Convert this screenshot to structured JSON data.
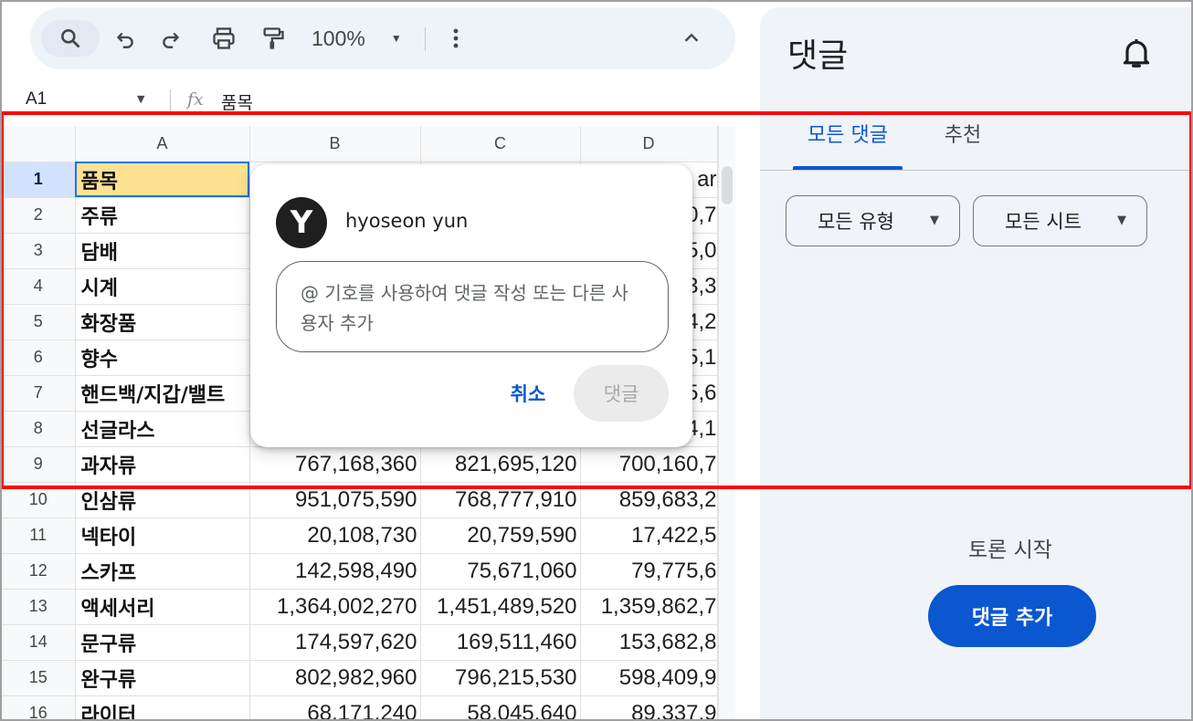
{
  "toolbar": {
    "zoom": "100%",
    "icons": [
      "search-icon",
      "undo-icon",
      "redo-icon",
      "print-icon",
      "paint-format-icon",
      "chevron-down-icon",
      "more-vert-icon",
      "chevron-up-icon"
    ]
  },
  "formula_bar": {
    "cell_ref": "A1",
    "fx": "fx",
    "value": "품목"
  },
  "grid": {
    "columns": [
      "A",
      "B",
      "C",
      "D"
    ],
    "rows": [
      {
        "n": "1",
        "a": "품목",
        "b": "",
        "c": "",
        "d": "ar"
      },
      {
        "n": "2",
        "a": "주류",
        "b": "",
        "c": "",
        "d": "0,7"
      },
      {
        "n": "3",
        "a": "담배",
        "b": "",
        "c": "",
        "d": "5,0"
      },
      {
        "n": "4",
        "a": "시계",
        "b": "",
        "c": "",
        "d": "3,3"
      },
      {
        "n": "5",
        "a": "화장품",
        "b": "",
        "c": "",
        "d": "4,2"
      },
      {
        "n": "6",
        "a": "향수",
        "b": "",
        "c": "",
        "d": "5,1"
      },
      {
        "n": "7",
        "a": "핸드백/지갑/밸트",
        "b": "",
        "c": "",
        "d": "5,6"
      },
      {
        "n": "8",
        "a": "선글라스",
        "b": "",
        "c": "",
        "d": "4,1"
      },
      {
        "n": "9",
        "a": "과자류",
        "b": "767,168,360",
        "c": "821,695,120",
        "d": "700,160,7"
      },
      {
        "n": "10",
        "a": "인삼류",
        "b": "951,075,590",
        "c": "768,777,910",
        "d": "859,683,2"
      },
      {
        "n": "11",
        "a": "넥타이",
        "b": "20,108,730",
        "c": "20,759,590",
        "d": "17,422,5"
      },
      {
        "n": "12",
        "a": "스카프",
        "b": "142,598,490",
        "c": "75,671,060",
        "d": "79,775,6"
      },
      {
        "n": "13",
        "a": "액세서리",
        "b": "1,364,002,270",
        "c": "1,451,489,520",
        "d": "1,359,862,7"
      },
      {
        "n": "14",
        "a": "문구류",
        "b": "174,597,620",
        "c": "169,511,460",
        "d": "153,682,8"
      },
      {
        "n": "15",
        "a": "완구류",
        "b": "802,982,960",
        "c": "796,215,530",
        "d": "598,409,9"
      },
      {
        "n": "16",
        "a": "라이터",
        "b": "68,171,240",
        "c": "58,045,640",
        "d": "89,337,9"
      }
    ]
  },
  "comment_popup": {
    "avatar_letter": "Y",
    "username": "hyoseon yun",
    "placeholder": "@ 기호를 사용하여 댓글 작성 또는 다른 사용자 추가",
    "cancel": "취소",
    "submit": "댓글"
  },
  "panel": {
    "title": "댓글",
    "tabs": [
      "모든 댓글",
      "추천"
    ],
    "filters": [
      "모든 유형",
      "모든 시트"
    ],
    "empty_text": "토론 시작",
    "add_button": "댓글 추가"
  },
  "colors": {
    "accent": "#0b57d0",
    "selected_cell": "#fde293",
    "annotation": "#ff0000",
    "panel_bg": "#f0f4f9"
  }
}
